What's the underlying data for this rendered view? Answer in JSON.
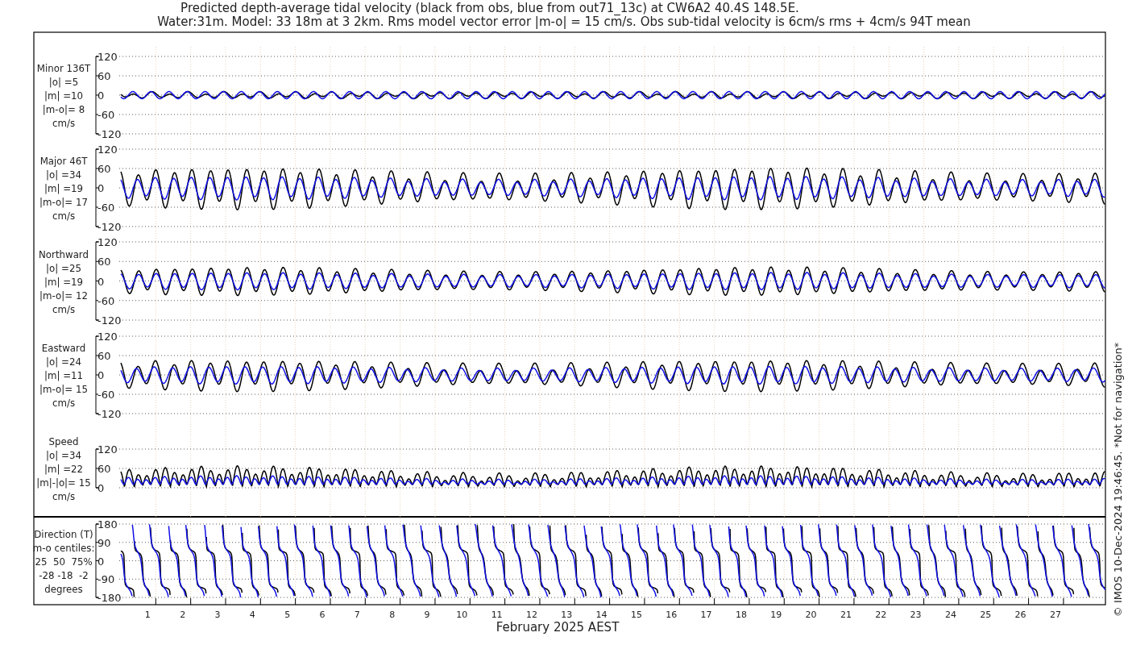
{
  "title": [
    "Predicted depth-average tidal velocity (black from obs, blue from out71_13c) at CW6A2 40.4S 148.5E.",
    "Water:31m. Model: 33 18m at 3 2km. Rms model vector error |m-o| = 15 cm/s. Obs sub-tidal velocity is 6cm/s rms + 4cm/s 94T mean"
  ],
  "panels": [
    {
      "kind": "minor",
      "label": [
        "Minor 136T",
        "|o| =5",
        "|m| =10",
        "|m-o|= 8",
        "cm/s"
      ],
      "yticks": [
        "120",
        "60",
        "0",
        "-60",
        "-120"
      ]
    },
    {
      "kind": "major",
      "label": [
        "Major 46T",
        "|o| =34",
        "|m| =19",
        "|m-o|= 17",
        "cm/s"
      ],
      "yticks": [
        "120",
        "60",
        "0",
        "-60",
        "-120"
      ]
    },
    {
      "kind": "north",
      "label": [
        "Northward",
        "|o| =25",
        "|m| =19",
        "|m-o|= 12",
        "cm/s"
      ],
      "yticks": [
        "120",
        "60",
        "0",
        "-60",
        "-120"
      ]
    },
    {
      "kind": "east",
      "label": [
        "Eastward",
        "|o| =24",
        "|m| =11",
        "|m-o|= 15",
        "cm/s"
      ],
      "yticks": [
        "120",
        "60",
        "0",
        "-60",
        "-120"
      ]
    },
    {
      "kind": "speed",
      "label": [
        "Speed",
        "|o| =34",
        "|m| =22",
        "|m|-|o|= 15",
        "cm/s"
      ],
      "yticks": [
        "120",
        "60",
        "0"
      ]
    },
    {
      "kind": "direction",
      "label": [
        "Direction (T)",
        "m-o centiles:",
        "25  50  75%",
        "-28 -18  -2",
        "degrees"
      ],
      "yticks": [
        "180",
        "90",
        "0",
        "-90",
        "-180"
      ]
    }
  ],
  "x_axis": {
    "ticks": [
      "1",
      "2",
      "3",
      "4",
      "5",
      "6",
      "7",
      "8",
      "9",
      "10",
      "11",
      "12",
      "13",
      "14",
      "15",
      "16",
      "17",
      "18",
      "19",
      "20",
      "21",
      "22",
      "23",
      "24",
      "25",
      "26",
      "27"
    ],
    "label": "February 2025 AEST"
  },
  "credit": "© IMOS 10-Dec-2024 19:46:45. *Not for navigation*"
}
